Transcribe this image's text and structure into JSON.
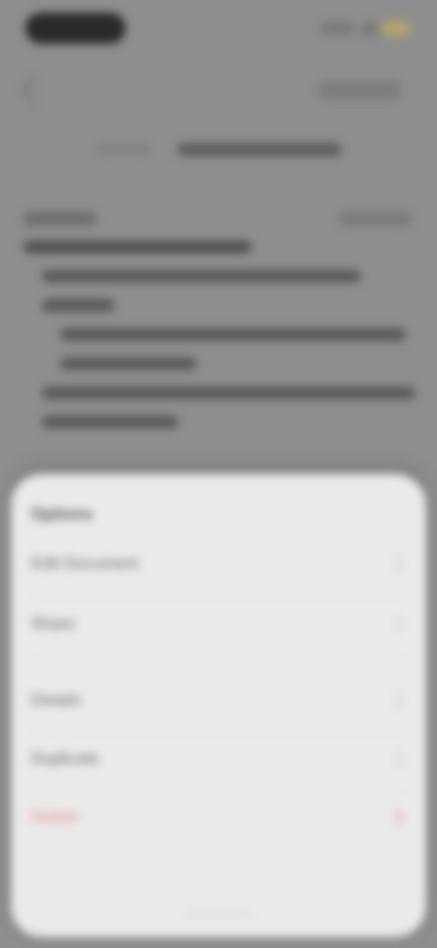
{
  "status_bar": {
    "time": "9:41"
  },
  "header": {
    "title": "",
    "actions_icon": "more-icon"
  },
  "sheet": {
    "title": "Options",
    "items": [
      {
        "label": "Edit Document",
        "style": "normal"
      },
      {
        "label": "Share",
        "style": "normal"
      },
      {
        "label": "Details",
        "style": "normal"
      },
      {
        "label": "Duplicate",
        "style": "normal"
      },
      {
        "label": "Delete",
        "style": "destructive"
      }
    ]
  },
  "colors": {
    "destructive": "#e58a8a",
    "sheet_bg": "#eaeaea",
    "dim_bg": "#8e8e8e"
  }
}
